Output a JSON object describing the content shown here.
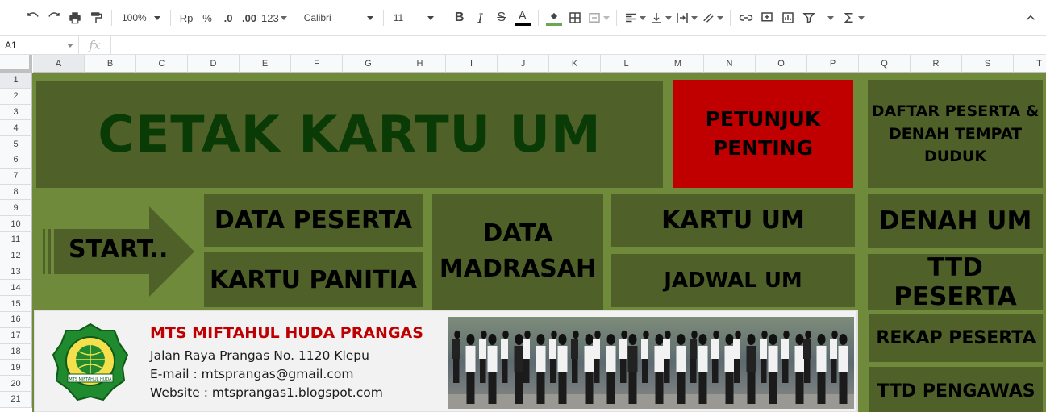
{
  "toolbar": {
    "zoom": "100%",
    "currency": "Rp",
    "percent": "%",
    "dec_decrease": ".0",
    "dec_increase": ".00",
    "more_formats": "123",
    "font": "Calibri",
    "font_size": "11",
    "bold": "B",
    "italic": "I",
    "strike": "S",
    "text_color_glyph": "A",
    "text_color": "#000000",
    "fill_color": "#6aa84f"
  },
  "formula_bar": {
    "cell_ref": "A1",
    "fx": "fx",
    "content": ""
  },
  "grid": {
    "columns": [
      "A",
      "B",
      "C",
      "D",
      "E",
      "F",
      "G",
      "H",
      "I",
      "J",
      "K",
      "L",
      "M",
      "N",
      "O",
      "P",
      "Q",
      "R",
      "S",
      "T"
    ],
    "rows": [
      "1",
      "2",
      "3",
      "4",
      "5",
      "6",
      "7",
      "8",
      "9",
      "10",
      "11",
      "12",
      "13",
      "14",
      "15",
      "16",
      "17",
      "18",
      "19",
      "20",
      "21"
    ]
  },
  "dashboard": {
    "title": "CETAK KARTU UM",
    "petunjuk": "PETUNJUK PENTING",
    "daftar_peserta": "DAFTAR PESERTA & DENAH TEMPAT DUDUK",
    "start": "START..",
    "data_peserta": "DATA PESERTA",
    "kartu_panitia": "KARTU PANITIA",
    "data_madrasah": "DATA MADRASAH",
    "kartu_um": "KARTU UM",
    "jadwal_um": "JADWAL UM",
    "denah_um": "DENAH UM",
    "ttd_peserta": "TTD PESERTA",
    "rekap_peserta": "REKAP PESERTA",
    "ttd_pengawas": "TTD PENGAWAS"
  },
  "school": {
    "name": "MTS MIFTAHUL HUDA PRANGAS",
    "address": "Jalan Raya Prangas No. 1120 Klepu",
    "email": "E-mail : mtsprangas@gmail.com",
    "website": "Website : mtsprangas1.blogspot.com",
    "logo_text": "MTS MIFTAHUL HUDA"
  },
  "colors": {
    "sheet_bg": "#6e8a3a",
    "button_bg": "#4f6128",
    "title_text": "#0a3a06",
    "alert_bg": "#c00000",
    "school_name": "#c00000"
  }
}
